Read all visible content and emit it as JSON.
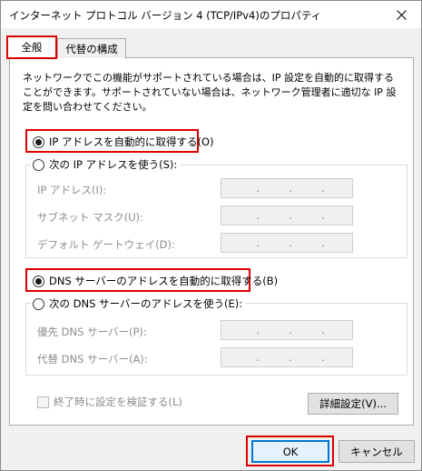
{
  "window": {
    "title": "インターネット プロトコル バージョン 4 (TCP/IPv4)のプロパティ"
  },
  "tabs": [
    {
      "label": "全般",
      "selected": true
    },
    {
      "label": "代替の構成",
      "selected": false
    }
  ],
  "description": "ネットワークでこの機能がサポートされている場合は、IP 設定を自動的に取得することができます。サポートされていない場合は、ネットワーク管理者に適切な IP 設定を問い合わせてください。",
  "ip": {
    "auto_label": "IP アドレスを自動的に取得する(O)",
    "auto_selected": true,
    "manual_label": "次の IP アドレスを使う(S):",
    "manual_selected": false,
    "fields": [
      {
        "label": "IP アドレス(I):",
        "value": ". . ."
      },
      {
        "label": "サブネット マスク(U):",
        "value": ". . ."
      },
      {
        "label": "デフォルト ゲートウェイ(D):",
        "value": ". . ."
      }
    ]
  },
  "dns": {
    "auto_label": "DNS サーバーのアドレスを自動的に取得する(B)",
    "auto_selected": true,
    "manual_label": "次の DNS サーバーのアドレスを使う(E):",
    "manual_selected": false,
    "fields": [
      {
        "label": "優先 DNS サーバー(P):",
        "value": ". . ."
      },
      {
        "label": "代替 DNS サーバー(A):",
        "value": ". . ."
      }
    ]
  },
  "validate": {
    "label": "終了時に設定を検証する(L)",
    "checked": false,
    "enabled": false
  },
  "buttons": {
    "advanced": "詳細設定(V)...",
    "ok": "OK",
    "cancel": "キャンセル"
  },
  "colors": {
    "highlight": "#e00000",
    "ok_border": "#0078d7"
  }
}
